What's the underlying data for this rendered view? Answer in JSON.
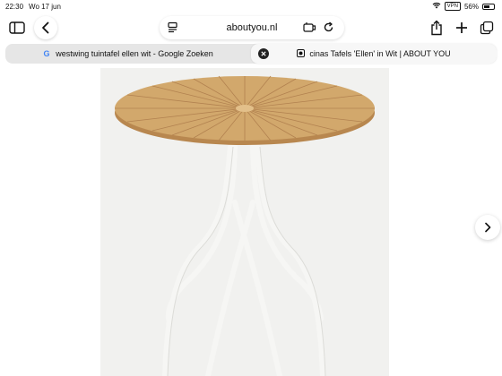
{
  "status_bar": {
    "time": "22:30",
    "date": "Wo 17 jun",
    "vpn": "VPN",
    "battery": "56%"
  },
  "toolbar": {
    "url": "aboutyou.nl",
    "icons": [
      "sidebar-icon",
      "back-icon",
      "reader-icon",
      "extensions-icon",
      "reload-icon",
      "share-icon",
      "plus-icon",
      "tabs-icon"
    ]
  },
  "tabs": [
    {
      "title": "westwing tuintafel ellen wit - Google Zoeken",
      "favicon": "G",
      "active": false
    },
    {
      "title": "cinas Tafels 'Ellen' in Wit | ABOUT YOU",
      "favicon": "about-you-favicon",
      "active": true
    }
  ],
  "product": {
    "image": "round-wood-top-white-bistro-table"
  },
  "colors": {
    "wood": "#d2a86c",
    "frame": "#f4f4f2",
    "background": "#f1f1ef"
  }
}
